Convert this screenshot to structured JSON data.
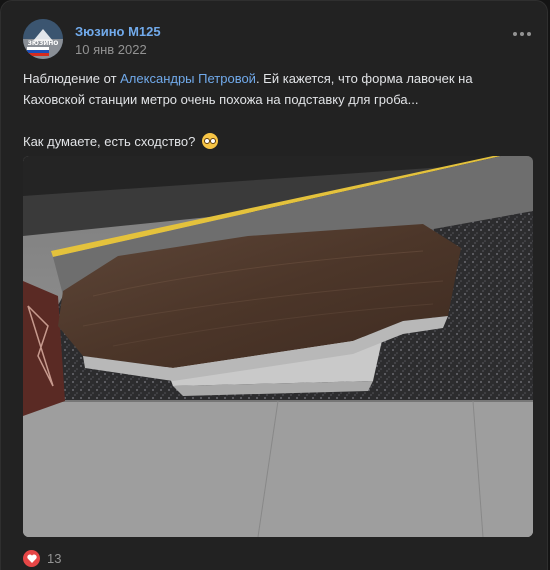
{
  "post": {
    "author": "Зюзино М125",
    "date": "10 янв 2022",
    "avatar_text": "ЗЮЗИНО",
    "text_before_link": "Наблюдение от ",
    "link_text": "Александры Петровой",
    "text_after_link": ". Ей кажется, что форма лавочек на Каховской станции метро очень похожа на подставку для гроба...",
    "question": "Как думаете, есть сходство?",
    "likes": "13"
  },
  "colors": {
    "background": "#222222",
    "link": "#71aaeb",
    "like": "#e64646"
  },
  "icons": [
    "more-icon",
    "emoji-icon",
    "heart-icon"
  ]
}
